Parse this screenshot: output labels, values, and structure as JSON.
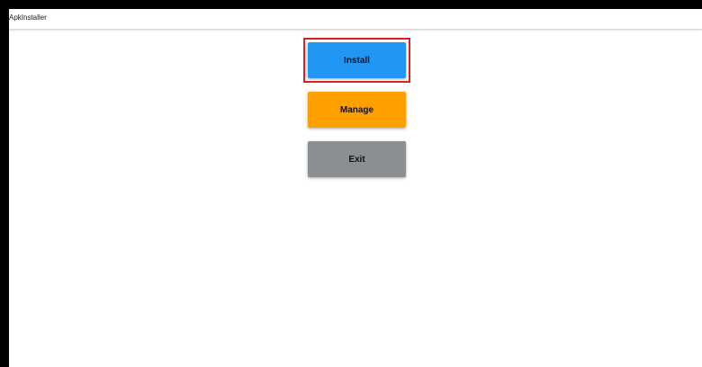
{
  "window": {
    "title": "ApkInstaller"
  },
  "main": {
    "install_label": "Install",
    "manage_label": "Manage",
    "exit_label": "Exit"
  },
  "colors": {
    "install": "#2196f3",
    "manage": "#ff9f00",
    "exit": "#8c8f92",
    "highlight": "#e02020"
  }
}
